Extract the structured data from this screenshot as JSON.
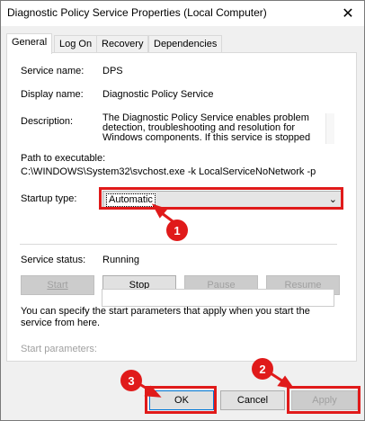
{
  "window": {
    "title": "Diagnostic Policy Service Properties (Local Computer)",
    "close_glyph": "✕"
  },
  "tabs": [
    "General",
    "Log On",
    "Recovery",
    "Dependencies"
  ],
  "general": {
    "service_name_label": "Service name:",
    "service_name": "DPS",
    "display_name_label": "Display name:",
    "display_name": "Diagnostic Policy Service",
    "description_label": "Description:",
    "description": "The Diagnostic Policy Service enables problem detection, troubleshooting and resolution for Windows components.  If this service is stopped",
    "path_label": "Path to executable:",
    "path": "C:\\WINDOWS\\System32\\svchost.exe -k LocalServiceNoNetwork -p",
    "startup_type_label": "Startup type:",
    "startup_type": "Automatic",
    "service_status_label": "Service status:",
    "service_status": "Running",
    "start_button": "Start",
    "stop_button": "Stop",
    "pause_button": "Pause",
    "resume_button": "Resume",
    "help_text": "You can specify the start parameters that apply when you start the service from here.",
    "start_params_label": "Start parameters:",
    "start_params_value": ""
  },
  "footer": {
    "ok_button": "OK",
    "cancel_button": "Cancel",
    "apply_button": "Apply"
  },
  "annotations": {
    "marker_1": "1",
    "marker_2": "2",
    "marker_3": "3",
    "highlight_color": "#e01a1a"
  }
}
